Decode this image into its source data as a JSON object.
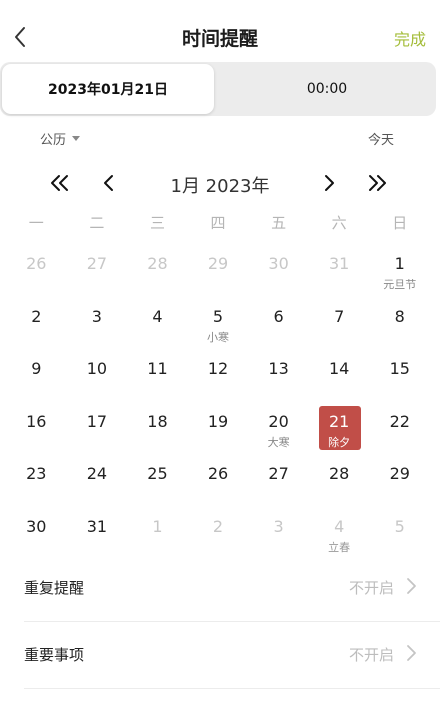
{
  "header": {
    "title": "时间提醒",
    "done": "完成"
  },
  "segments": {
    "date": "2023年01月21日",
    "time": "00:00"
  },
  "calendar": {
    "mode": "公历",
    "today": "今天",
    "month_label": "1月 2023年",
    "weekdays": [
      "一",
      "二",
      "三",
      "四",
      "五",
      "六",
      "日"
    ],
    "weeks": [
      [
        {
          "d": "26",
          "m": true
        },
        {
          "d": "27",
          "m": true
        },
        {
          "d": "28",
          "m": true
        },
        {
          "d": "29",
          "m": true
        },
        {
          "d": "30",
          "m": true
        },
        {
          "d": "31",
          "m": true
        },
        {
          "d": "1",
          "s": "元旦节"
        }
      ],
      [
        {
          "d": "2"
        },
        {
          "d": "3"
        },
        {
          "d": "4"
        },
        {
          "d": "5",
          "s": "小寒"
        },
        {
          "d": "6"
        },
        {
          "d": "7"
        },
        {
          "d": "8"
        }
      ],
      [
        {
          "d": "9"
        },
        {
          "d": "10"
        },
        {
          "d": "11"
        },
        {
          "d": "12"
        },
        {
          "d": "13"
        },
        {
          "d": "14"
        },
        {
          "d": "15"
        }
      ],
      [
        {
          "d": "16"
        },
        {
          "d": "17"
        },
        {
          "d": "18"
        },
        {
          "d": "19"
        },
        {
          "d": "20",
          "s": "大寒"
        },
        {
          "d": "21",
          "s": "除夕",
          "sel": true
        },
        {
          "d": "22"
        }
      ],
      [
        {
          "d": "23"
        },
        {
          "d": "24"
        },
        {
          "d": "25"
        },
        {
          "d": "26"
        },
        {
          "d": "27"
        },
        {
          "d": "28"
        },
        {
          "d": "29"
        }
      ],
      [
        {
          "d": "30"
        },
        {
          "d": "31"
        },
        {
          "d": "1",
          "m": true
        },
        {
          "d": "2",
          "m": true
        },
        {
          "d": "3",
          "m": true
        },
        {
          "d": "4",
          "m": true,
          "s": "立春"
        },
        {
          "d": "5",
          "m": true
        }
      ]
    ]
  },
  "settings": [
    {
      "label": "重复提醒",
      "value": "不开启"
    },
    {
      "label": "重要事项",
      "value": "不开启"
    }
  ],
  "colors": {
    "accent": "#a4bd3a",
    "selected": "#c14e48"
  }
}
